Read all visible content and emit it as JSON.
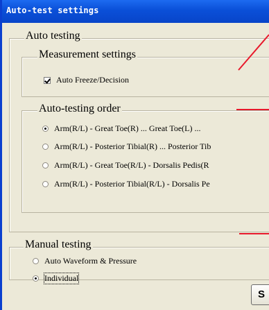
{
  "window": {
    "title": "Auto-test settings"
  },
  "auto_testing": {
    "label": "Auto testing",
    "measurement_settings": {
      "label": "Measurement settings",
      "auto_freeze": {
        "label": "Auto Freeze/Decision",
        "checked": true
      }
    },
    "order": {
      "label": "Auto-testing order",
      "options": [
        {
          "label": "Arm(R/L) - Great Toe(R) ... Great Toe(L) ...",
          "selected": true
        },
        {
          "label": "Arm(R/L) - Posterior Tibial(R) ... Posterior Tib",
          "selected": false
        },
        {
          "label": "Arm(R/L) - Great Toe(R/L) - Dorsalis Pedis(R",
          "selected": false
        },
        {
          "label": "Arm(R/L) - Posterior Tibial(R/L) - Dorsalis Pe",
          "selected": false
        }
      ]
    }
  },
  "manual_testing": {
    "label": "Manual testing",
    "options": [
      {
        "label": "Auto Waveform & Pressure",
        "selected": false
      },
      {
        "label": "Individual",
        "selected": true
      }
    ]
  },
  "partial_button": {
    "label": "S"
  },
  "colors": {
    "title_bar": "#0a4fd8",
    "dialog_bg": "#ece9d8",
    "annotation_arrow": "#e8192c"
  }
}
